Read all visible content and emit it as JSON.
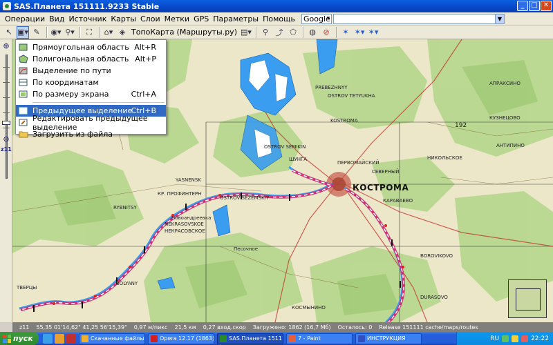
{
  "window": {
    "title": "SAS.Планета 151111.9233 Stable",
    "buttons": {
      "minimize": "_",
      "maximize": "□",
      "close": "✕"
    }
  },
  "menubar": {
    "items": [
      "Операции",
      "Вид",
      "Источник",
      "Карты",
      "Слои",
      "Метки",
      "GPS",
      "Параметры",
      "Помощь"
    ],
    "search_engine": "Google"
  },
  "toolbar": {
    "map_name": "ТопоКарта (Маршруты.ру)"
  },
  "zoom": {
    "level": "z11",
    "plus": "+",
    "minus": "−"
  },
  "dropdown": {
    "items": [
      {
        "label": "Прямоугольная область",
        "shortcut": "Alt+R"
      },
      {
        "label": "Полигональная область",
        "shortcut": "Alt+P"
      },
      {
        "label": "Выделение по пути",
        "shortcut": ""
      },
      {
        "label": "По координатам",
        "shortcut": ""
      },
      {
        "label": "По размеру экрана",
        "shortcut": "Ctrl+A"
      },
      {
        "label": "Предыдущее выделение",
        "shortcut": "Ctrl+B",
        "selected": true
      },
      {
        "label": "Редактировать предыдущее выделение",
        "shortcut": ""
      },
      {
        "label": "Загрузить из файла",
        "shortcut": ""
      }
    ]
  },
  "map": {
    "labels": {
      "kostroma": "КОСТРОМА",
      "prebezhnyy": "PREBEZHNYY",
      "ostrov_tetyukha": "OSTROV TETYUKHA",
      "kostroma_small": "KOSTROMA",
      "ostrov_semikin": "OSTROV SEMIKIN",
      "ostrov_sezemskiy": "OSTROV SEZEMSKIY",
      "yasnenskoye": "YASNENSK",
      "nekrasovskoe_lat": "NEKRASOVSKOE",
      "nekrasovskoe": "НЕКРАСОВСКОЕ",
      "krasnyy_profintern": "КР. ПРОФИНТЕРН",
      "rybnitsy": "RYBNITSY",
      "tvertsy": "ТВЕРЦЫ",
      "bolyany": "BOLYANY",
      "borovikovo": "BOROVIKOVO",
      "durasovo": "DURASOVO",
      "kosmynino": "КОСМЫНИНО",
      "severny": "СЕВЕРНЫЙ",
      "karabaevo": "КАРАВАЕВО",
      "apraksino": "АПРАКСИНО",
      "kuznetsovo": "КУЗНЕЦОВО",
      "antipino": "АНТИПИНО",
      "nikolskoe": "НИКОЛЬСКОЕ",
      "shunga": "ШУНГА",
      "pervomayskiy": "ПЕРВОМАЙСКИЙ",
      "novoandreevka": "Новоандреевка",
      "sopyrevo": "Песочное",
      "num_192": "192"
    }
  },
  "statusbar": {
    "items": [
      "z11",
      "55,35 01'14,62\"  41,25 56'15,39\"",
      "0,97 м/пикс",
      "21,5 км",
      "0,27 вход.скор",
      "Загружено: 1862 (16,7 Мб)",
      "Осталось: 0",
      "Release 151111 cache/maps/routes"
    ]
  },
  "taskbar": {
    "start": "пуск",
    "tasks": [
      {
        "label": "Скачанные файлы - ...",
        "color": "#f0b030"
      },
      {
        "label": "Opera 12.17 (1863): ...",
        "color": "#d02020"
      },
      {
        "label": "SAS.Планета 151111...",
        "color": "#2a8a2a",
        "active": true
      },
      {
        "label": "7 - Paint",
        "color": "#e06040"
      },
      {
        "label": "ИНСТРУКЦИЯ",
        "color": "#3050c0"
      }
    ],
    "lang": "RU",
    "clock": "22:22"
  },
  "colors": {
    "titlebar": "#0a5fe0",
    "selection": "#316ac5",
    "route": "#cc3377",
    "water": "#3b9df0",
    "forest": "#b8d890",
    "field": "#f2eed8",
    "city": "#c85a4a"
  }
}
